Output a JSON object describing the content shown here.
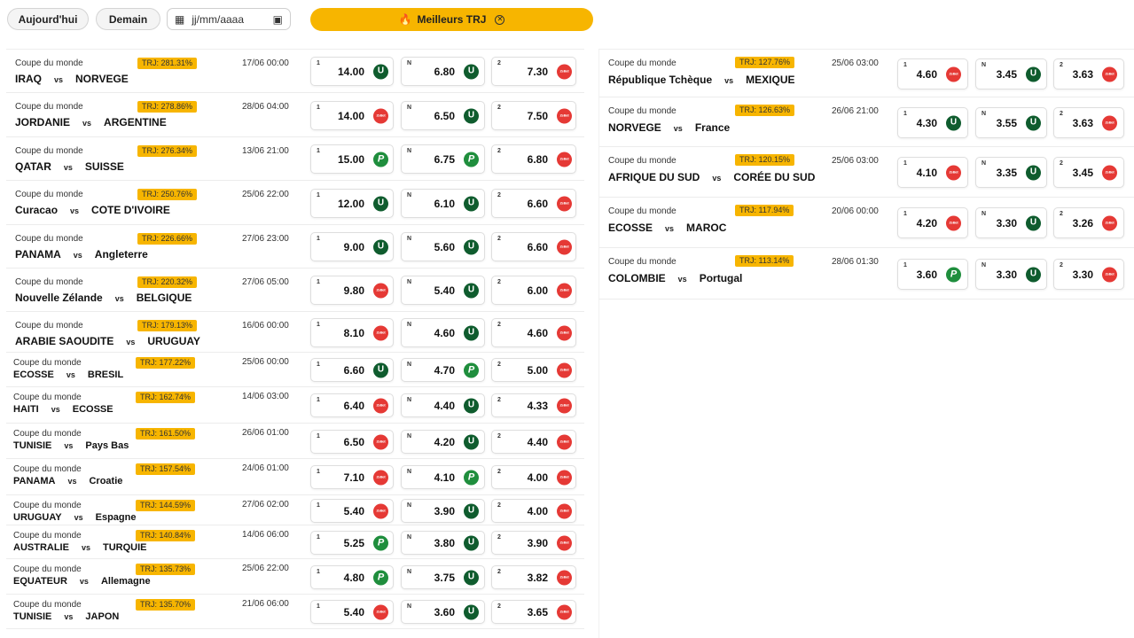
{
  "toolbar": {
    "today_label": "Aujourd'hui",
    "tomorrow_label": "Demain",
    "date_placeholder": "jj/mm/aaaa",
    "best_trj_label": "Meilleurs TRJ",
    "fire_icon": "🔥",
    "calendar_icon": "▦",
    "calendar_right_icon": "▣",
    "close_icon": "✕"
  },
  "bookmakers": {
    "U": {
      "name": "Unibet",
      "glyph": "U",
      "color": "#0f5c2e"
    },
    "P": {
      "name": "PMU",
      "glyph": "P",
      "color": "#1f8e3d"
    },
    "Z": {
      "name": "Zebet",
      "glyph": "ZeBet",
      "color": "#e53935"
    }
  },
  "labels": {
    "home": "1",
    "draw": "N",
    "away": "2",
    "vs": "vs"
  },
  "matches_left": [
    {
      "comp": "Coupe du monde",
      "trj": "TRJ: 281.31%",
      "date": "17/06 00:00",
      "home": "IRAQ",
      "away": "NORVEGE",
      "o1": "14.00",
      "b1": "U",
      "on": "6.80",
      "bn": "U",
      "o2": "7.30",
      "b2": "Z"
    },
    {
      "comp": "Coupe du monde",
      "trj": "TRJ: 278.86%",
      "date": "28/06 04:00",
      "home": "JORDANIE",
      "away": "ARGENTINE",
      "o1": "14.00",
      "b1": "Z",
      "on": "6.50",
      "bn": "U",
      "o2": "7.50",
      "b2": "Z"
    },
    {
      "comp": "Coupe du monde",
      "trj": "TRJ: 276.34%",
      "date": "13/06 21:00",
      "home": "QATAR",
      "away": "SUISSE",
      "o1": "15.00",
      "b1": "P",
      "on": "6.75",
      "bn": "P",
      "o2": "6.80",
      "b2": "Z"
    },
    {
      "comp": "Coupe du monde",
      "trj": "TRJ: 250.76%",
      "date": "25/06 22:00",
      "home": "Curacao",
      "away": "COTE D'IVOIRE",
      "o1": "12.00",
      "b1": "U",
      "on": "6.10",
      "bn": "U",
      "o2": "6.60",
      "b2": "Z"
    },
    {
      "comp": "Coupe du monde",
      "trj": "TRJ: 226.66%",
      "date": "27/06 23:00",
      "home": "PANAMA",
      "away": "Angleterre",
      "o1": "9.00",
      "b1": "U",
      "on": "5.60",
      "bn": "U",
      "o2": "6.60",
      "b2": "Z"
    },
    {
      "comp": "Coupe du monde",
      "trj": "TRJ: 220.32%",
      "date": "27/06 05:00",
      "home": "Nouvelle Zélande",
      "away": "BELGIQUE",
      "o1": "9.80",
      "b1": "Z",
      "on": "5.40",
      "bn": "U",
      "o2": "6.00",
      "b2": "Z"
    },
    {
      "comp": "Coupe du monde",
      "trj": "TRJ: 179.13%",
      "date": "16/06 00:00",
      "home": "ARABIE SAOUDITE",
      "away": "URUGUAY",
      "o1": "8.10",
      "b1": "Z",
      "on": "4.60",
      "bn": "U",
      "o2": "4.60",
      "b2": "Z"
    },
    {
      "comp": "Coupe du monde",
      "trj": "TRJ: 177.22%",
      "date": "25/06 00:00",
      "home": "ECOSSE",
      "away": "BRESIL",
      "o1": "6.60",
      "b1": "U",
      "on": "4.70",
      "bn": "P",
      "o2": "5.00",
      "b2": "Z"
    },
    {
      "comp": "Coupe du monde",
      "trj": "TRJ: 162.74%",
      "date": "14/06 03:00",
      "home": "HAITI",
      "away": "ECOSSE",
      "o1": "6.40",
      "b1": "Z",
      "on": "4.40",
      "bn": "U",
      "o2": "4.33",
      "b2": "Z"
    },
    {
      "comp": "Coupe du monde",
      "trj": "TRJ: 161.50%",
      "date": "26/06 01:00",
      "home": "TUNISIE",
      "away": "Pays Bas",
      "o1": "6.50",
      "b1": "Z",
      "on": "4.20",
      "bn": "U",
      "o2": "4.40",
      "b2": "Z"
    },
    {
      "comp": "Coupe du monde",
      "trj": "TRJ: 157.54%",
      "date": "24/06 01:00",
      "home": "PANAMA",
      "away": "Croatie",
      "o1": "7.10",
      "b1": "Z",
      "on": "4.10",
      "bn": "P",
      "o2": "4.00",
      "b2": "Z"
    },
    {
      "comp": "Coupe du monde",
      "trj": "TRJ: 144.59%",
      "date": "27/06 02:00",
      "home": "URUGUAY",
      "away": "Espagne",
      "o1": "5.40",
      "b1": "Z",
      "on": "3.90",
      "bn": "U",
      "o2": "4.00",
      "b2": "Z"
    },
    {
      "comp": "Coupe du monde",
      "trj": "TRJ: 140.84%",
      "date": "14/06 06:00",
      "home": "AUSTRALIE",
      "away": "TURQUIE",
      "o1": "5.25",
      "b1": "P",
      "on": "3.80",
      "bn": "U",
      "o2": "3.90",
      "b2": "Z"
    },
    {
      "comp": "Coupe du monde",
      "trj": "TRJ: 135.73%",
      "date": "25/06 22:00",
      "home": "EQUATEUR",
      "away": "Allemagne",
      "o1": "4.80",
      "b1": "P",
      "on": "3.75",
      "bn": "U",
      "o2": "3.82",
      "b2": "Z"
    },
    {
      "comp": "Coupe du monde",
      "trj": "TRJ: 135.70%",
      "date": "21/06 06:00",
      "home": "TUNISIE",
      "away": "JAPON",
      "o1": "5.40",
      "b1": "Z",
      "on": "3.60",
      "bn": "U",
      "o2": "3.65",
      "b2": "Z"
    }
  ],
  "matches_right": [
    {
      "comp": "Coupe du monde",
      "trj": "TRJ: 127.76%",
      "date": "25/06 03:00",
      "home": "République Tchèque",
      "away": "MEXIQUE",
      "o1": "4.60",
      "b1": "Z",
      "on": "3.45",
      "bn": "U",
      "o2": "3.63",
      "b2": "Z"
    },
    {
      "comp": "Coupe du monde",
      "trj": "TRJ: 126.63%",
      "date": "26/06 21:00",
      "home": "NORVEGE",
      "away": "France",
      "o1": "4.30",
      "b1": "U",
      "on": "3.55",
      "bn": "U",
      "o2": "3.63",
      "b2": "Z"
    },
    {
      "comp": "Coupe du monde",
      "trj": "TRJ: 120.15%",
      "date": "25/06 03:00",
      "home": "AFRIQUE DU SUD",
      "away": "CORÉE DU SUD",
      "o1": "4.10",
      "b1": "Z",
      "on": "3.35",
      "bn": "U",
      "o2": "3.45",
      "b2": "Z"
    },
    {
      "comp": "Coupe du monde",
      "trj": "TRJ: 117.94%",
      "date": "20/06 00:00",
      "home": "ECOSSE",
      "away": "MAROC",
      "o1": "4.20",
      "b1": "Z",
      "on": "3.30",
      "bn": "U",
      "o2": "3.26",
      "b2": "Z"
    },
    {
      "comp": "Coupe du monde",
      "trj": "TRJ: 113.14%",
      "date": "28/06 01:30",
      "home": "COLOMBIE",
      "away": "Portugal",
      "o1": "3.60",
      "b1": "P",
      "on": "3.30",
      "bn": "U",
      "o2": "3.30",
      "b2": "Z"
    }
  ]
}
